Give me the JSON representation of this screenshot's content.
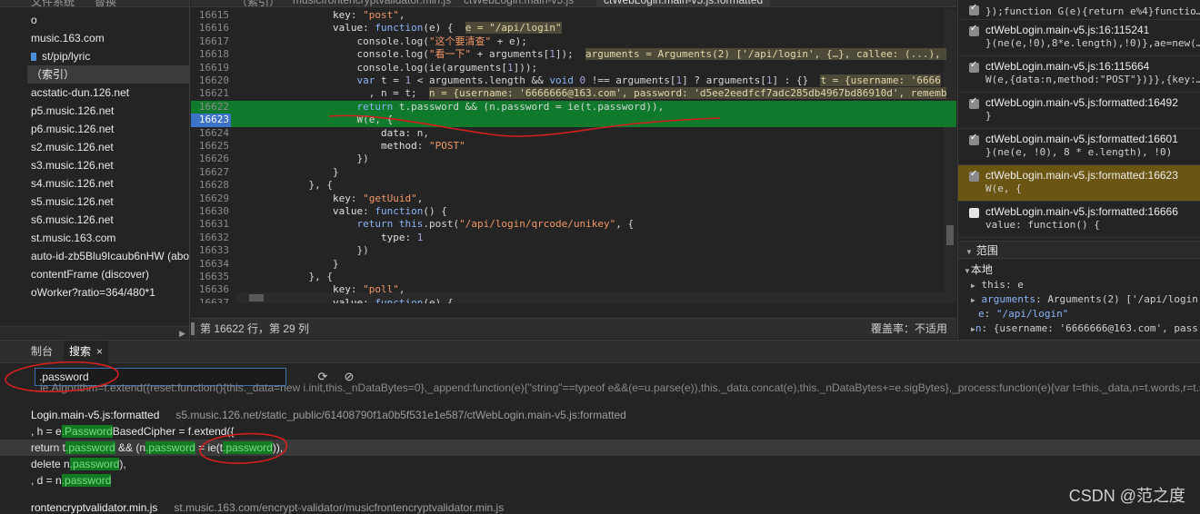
{
  "left": {
    "tabs": [
      "文件系统",
      "替换"
    ],
    "tree": [
      {
        "label": "o",
        "selected": false
      },
      {
        "label": "music.163.com",
        "selected": false
      },
      {
        "label": "st/pip/lyric",
        "selected": false,
        "folder": true
      },
      {
        "label": "（索引）",
        "selected": true
      },
      {
        "label": "acstatic-dun.126.net",
        "selected": false
      },
      {
        "label": "p5.music.126.net",
        "selected": false
      },
      {
        "label": "p6.music.126.net",
        "selected": false
      },
      {
        "label": "s2.music.126.net",
        "selected": false
      },
      {
        "label": "s3.music.126.net",
        "selected": false
      },
      {
        "label": "s4.music.126.net",
        "selected": false
      },
      {
        "label": "s5.music.126.net",
        "selected": false
      },
      {
        "label": "s6.music.126.net",
        "selected": false
      },
      {
        "label": "st.music.163.com",
        "selected": false
      },
      {
        "label": "auto-id-zb5Blu9Icaub6nHW (abo",
        "selected": false
      },
      {
        "label": "contentFrame (discover)",
        "selected": false
      },
      {
        "label": "oWorker?ratio=364/480*1",
        "selected": false
      }
    ]
  },
  "editor": {
    "tabs": [
      {
        "label": "（索引）",
        "active": false
      },
      {
        "label": "musicfrontencryptvalidator.min.js",
        "active": false
      },
      {
        "label": "ctWebLogin.main-v5.js",
        "active": false
      },
      {
        "label": "ctWebLogin.main-v5.js:formatted",
        "active": true
      }
    ],
    "status_position": "第 16622 行，第 29 列",
    "status_coverage": "覆盖率：不适用"
  },
  "code_lines": [
    {
      "n": "16615",
      "html": "                <span class=\"prop\">key</span>: <span class=\"str\">\"post\"</span>,"
    },
    {
      "n": "16616",
      "html": "                <span class=\"prop\">value</span>: <span class=\"kw\">function</span>(e) {  <span class=\"inl\">e = \"/api/login\"</span>"
    },
    {
      "n": "16617",
      "html": "                    console.log(<span class=\"str\">\"这个要清查\"</span> + e);"
    },
    {
      "n": "16618",
      "html": "                    console.log(<span class=\"str\">\"看一下\"</span> + arguments[<span class=\"num\">1</span>]);  <span class=\"inl\">arguments = Arguments(2) ['/api/login', {…}, callee: (...), </span>"
    },
    {
      "n": "16619",
      "html": "                    console.log(ie(arguments[<span class=\"num\">1</span>]));"
    },
    {
      "n": "16620",
      "html": "                    <span class=\"kw\">var</span> t = <span class=\"num\">1</span> &lt; arguments.length &amp;&amp; <span class=\"kw\">void</span> <span class=\"num\">0</span> !== arguments[<span class=\"num\">1</span>] ? arguments[<span class=\"num\">1</span>] : {}  <span class=\"inl\">t = {username: '6666</span>"
    },
    {
      "n": "16621",
      "html": "                      , n = t;  <span class=\"inl\">n = {username: '6666666@163.com', password: 'd5ee2eedfcf7adc285db4967bd86910d', rememb</span>"
    },
    {
      "n": "16622",
      "html": "                    <span class=\"kw\">return</span> t.password &amp;&amp; (n.password = ie(t.password)),",
      "hl": true
    },
    {
      "n": "16623",
      "html": "                    W(e, {",
      "hl": true,
      "bp": true
    },
    {
      "n": "16624",
      "html": "                        <span class=\"prop\">data</span>: n,"
    },
    {
      "n": "16625",
      "html": "                        <span class=\"prop\">method</span>: <span class=\"str\">\"POST\"</span>"
    },
    {
      "n": "16626",
      "html": "                    })"
    },
    {
      "n": "16627",
      "html": "                }"
    },
    {
      "n": "16628",
      "html": "            }, {"
    },
    {
      "n": "16629",
      "html": "                <span class=\"prop\">key</span>: <span class=\"str\">\"getUuid\"</span>,"
    },
    {
      "n": "16630",
      "html": "                <span class=\"prop\">value</span>: <span class=\"kw\">function</span>() {"
    },
    {
      "n": "16631",
      "html": "                    <span class=\"kw\">return</span> <span class=\"kw\">this</span>.post(<span class=\"str\">\"/api/login/qrcode/unikey\"</span>, {"
    },
    {
      "n": "16632",
      "html": "                        <span class=\"prop\">type</span>: <span class=\"num\">1</span>"
    },
    {
      "n": "16633",
      "html": "                    })"
    },
    {
      "n": "16634",
      "html": "                }"
    },
    {
      "n": "16635",
      "html": "            }, {"
    },
    {
      "n": "16636",
      "html": "                <span class=\"prop\">key</span>: <span class=\"str\">\"poll\"</span>,"
    },
    {
      "n": "16637",
      "html": "                <span class=\"prop\">value</span>: <span class=\"kw\">function</span>(e) {"
    },
    {
      "n": "16638",
      "html": ""
    }
  ],
  "breakpoints": [
    {
      "file": "",
      "code": "});function G(e){return e%4}functio…",
      "checked": true,
      "active": false,
      "partial": true
    },
    {
      "file": "ctWebLogin.main-v5.js:16:115241",
      "code": "}(ne(e,!0),8*e.length),!0)},ae=new(…",
      "checked": true,
      "active": false
    },
    {
      "file": "ctWebLogin.main-v5.js:16:115664",
      "code": "W(e,{data:n,method:\"POST\"})}},{key:…",
      "checked": true,
      "active": false
    },
    {
      "file": "ctWebLogin.main-v5.js:formatted:16492",
      "code": "}",
      "checked": true,
      "active": false
    },
    {
      "file": "ctWebLogin.main-v5.js:formatted:16601",
      "code": "}(ne(e, !0), 8 * e.length), !0)",
      "checked": true,
      "active": false
    },
    {
      "file": "ctWebLogin.main-v5.js:formatted:16623",
      "code": "W(e, {",
      "checked": true,
      "active": true
    },
    {
      "file": "ctWebLogin.main-v5.js:formatted:16666",
      "code": "value: function() {",
      "checked": false,
      "active": false
    }
  ],
  "scope": {
    "header": "范围",
    "local": "本地",
    "this_label": "this",
    "this_value": "e",
    "arguments_label": "arguments",
    "arguments_value": "Arguments(2) ['/api/login'",
    "e_label": "e",
    "e_value": "\"/api/login\"",
    "n_label": "n",
    "n_value": "{username: '6666666@163.com', pass"
  },
  "drawer": {
    "tabs": [
      {
        "label": "制台",
        "active": false
      },
      {
        "label": "搜索",
        "active": true
      }
    ],
    "search_value": ".password",
    "results": [
      {
        "kind": "line",
        "html": "<span class=\"faint\">...ie.Algorithm=f.extend({reset:function(){this._data=new i.init,this._nDataBytes=0},_append:function(e){\"string\"==typeof e&amp;&amp;(e=u.parse(e)),this._data.concat(e),this._nDataBytes+=e.sigBytes},_process:function(e){var t=this._data,n=t.words,r=t.sigBy</span>"
      },
      {
        "kind": "file",
        "file": "Login.main-v5.js:formatted",
        "path": "s5.music.126.net/static_public/61408790f1a0b5f531e1e587/ctWebLogin.main-v5.js:formatted"
      },
      {
        "kind": "line",
        "html": "  , h = e<span class=\"match\">.Password</span>BasedCipher = f.extend({"
      },
      {
        "kind": "line",
        "html": "  return t<span class=\"match\">.password</span> &amp;&amp; (n<span class=\"match\">.password</span> = ie(t<span class=\"match\">.password</span>)),",
        "cur": true
      },
      {
        "kind": "line",
        "html": "  delete n<span class=\"match\">.password</span>),"
      },
      {
        "kind": "line",
        "html": "  , d = n<span class=\"match\">.password</span>"
      },
      {
        "kind": "file",
        "file": "rontencryptvalidator.min.js",
        "path": "st.music.163.com/encrypt-validator/musicfrontencryptvalidator.min.js"
      }
    ]
  },
  "watermark": "CSDN @范之度",
  "colors": {
    "highlight_line": "#0f7a2c",
    "breakpoint": "#3a73c8",
    "active_breakpoint": "#6b5512",
    "annotation": "#d41f1f",
    "match": "#127a23"
  }
}
